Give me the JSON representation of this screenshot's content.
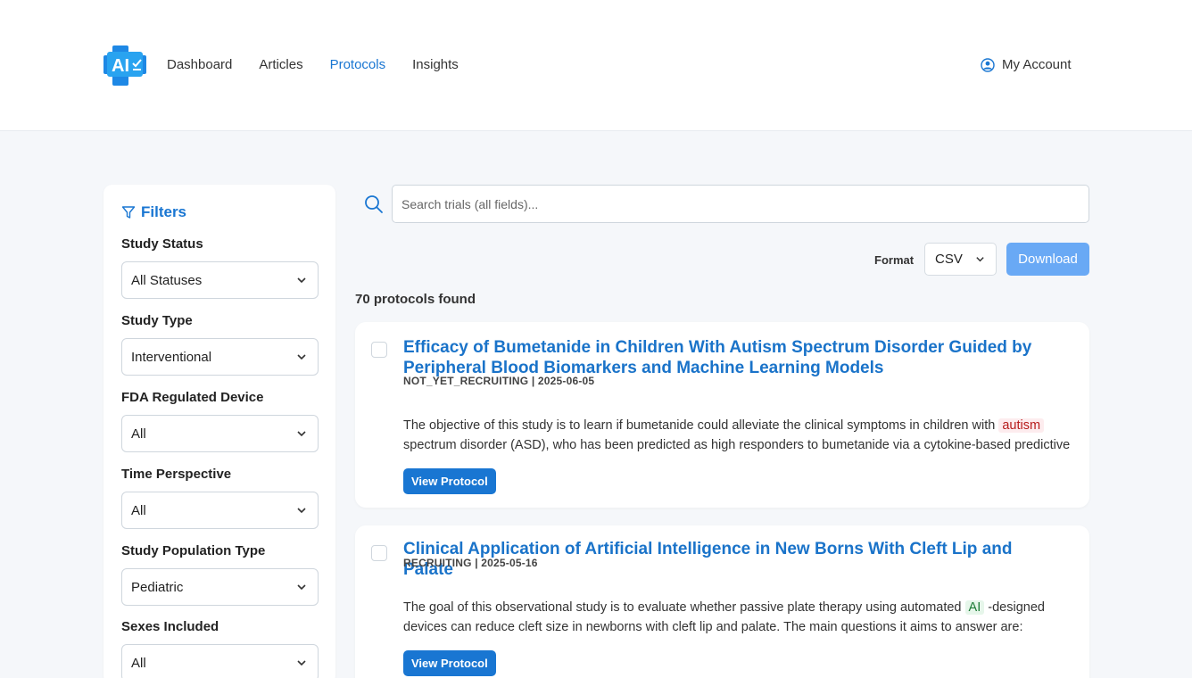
{
  "header": {
    "logo_text": "AI",
    "nav": [
      {
        "label": "Dashboard",
        "active": false
      },
      {
        "label": "Articles",
        "active": false
      },
      {
        "label": "Protocols",
        "active": true
      },
      {
        "label": "Insights",
        "active": false
      }
    ],
    "account_label": "My Account"
  },
  "sidebar": {
    "title": "Filters",
    "filters": [
      {
        "label": "Study Status",
        "value": "All Statuses"
      },
      {
        "label": "Study Type",
        "value": "Interventional"
      },
      {
        "label": "FDA Regulated Device",
        "value": "All"
      },
      {
        "label": "Time Perspective",
        "value": "All"
      },
      {
        "label": "Study Population Type",
        "value": "Pediatric"
      },
      {
        "label": "Sexes Included",
        "value": "All"
      }
    ]
  },
  "search": {
    "placeholder": "Search trials (all fields)...",
    "value": ""
  },
  "toolbar": {
    "format_label": "Format",
    "format_value": "CSV",
    "download_label": "Download"
  },
  "results": {
    "count_text": "70 protocols found",
    "items": [
      {
        "title": "Efficacy of Bumetanide in Children With Autism Spectrum Disorder Guided by Peripheral Blood Biomarkers and Machine Learning Models",
        "meta": "NOT_YET_RECRUITING | 2025-06-05",
        "desc_before": "The objective of this study is to learn if bumetanide could alleviate the clinical symptoms in children with ",
        "desc_highlight": "autism",
        "desc_after": " spectrum disorder (ASD), who has been predicted as high responders to bumetanide via a cytokine-based predictive",
        "button_label": "View Protocol"
      },
      {
        "title": "Clinical Application of Artificial Intelligence in New Borns With Cleft Lip and Palate",
        "meta": "RECRUITING | 2025-05-16",
        "desc_before": "The goal of this observational study is to evaluate whether passive plate therapy using automated ",
        "desc_highlight": "AI",
        "desc_after": " -designed devices can reduce cleft size in newborns with cleft lip and palate. The main questions it aims to answer are:",
        "button_label": "View Protocol"
      }
    ]
  },
  "colors": {
    "accent": "#1976d2",
    "download_button": "#69a9f5",
    "highlight_red_bg": "#fdecee",
    "highlight_green_bg": "#e6f6ea"
  }
}
